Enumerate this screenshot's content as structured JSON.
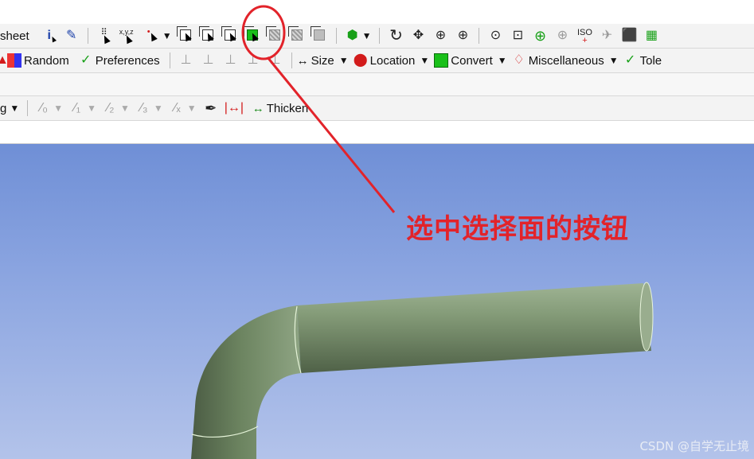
{
  "toolbar_row1": {
    "sheet_label": "sheet",
    "icons": [
      "info-cursor-icon",
      "tag-icon",
      "select-point-icon",
      "select-xyz-icon",
      "selection-mode-icon",
      "select-body-icon",
      "select-body-alt-icon",
      "select-face-icon",
      "select-green-face-icon",
      "select-gray-1-icon",
      "select-gray-2-icon",
      "select-gray-3-icon",
      "display-cube-icon",
      "rotate-icon",
      "pan-icon",
      "zoom-in-icon",
      "zoom-box-icon",
      "zoom-fit-icon",
      "zoom-green-icon",
      "zoom-gray-icon",
      "iso-icon",
      "look-at-icon",
      "view-cube-icon",
      "extra-icon"
    ]
  },
  "toolbar_row2": {
    "random_label": "Random",
    "preferences_label": "Preferences",
    "size_label": "Size",
    "location_label": "Location",
    "convert_label": "Convert",
    "misc_label": "Miscellaneous",
    "tolerance_label": "Tole"
  },
  "toolbar_row4": {
    "edge_label": "g",
    "thicken_label": "Thicken"
  },
  "annotation": {
    "text": "选中选择面的按钮",
    "color": "#e2232a"
  },
  "watermark": "CSDN @自学无止境"
}
